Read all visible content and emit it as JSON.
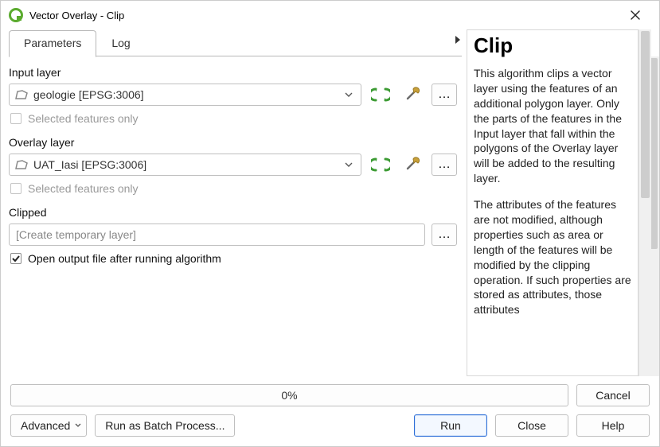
{
  "window": {
    "title": "Vector Overlay - Clip"
  },
  "tabs": {
    "parameters": "Parameters",
    "log": "Log"
  },
  "input": {
    "label": "Input layer",
    "value": "geologie [EPSG:3006]",
    "selected_only": "Selected features only"
  },
  "overlay": {
    "label": "Overlay layer",
    "value": "UAT_Iasi [EPSG:3006]",
    "selected_only": "Selected features only"
  },
  "output": {
    "label": "Clipped",
    "placeholder": "[Create temporary layer]",
    "open_after": "Open output file after running algorithm"
  },
  "help": {
    "title": "Clip",
    "p1": "This algorithm clips a vector layer using the features of an additional polygon layer. Only the parts of the features in the Input layer that fall within the polygons of the Overlay layer will be added to the resulting layer.",
    "p2": "The attributes of the features are not modified, although properties such as area or length of the features will be modified by the clipping operation. If such properties are stored as attributes, those attributes"
  },
  "footer": {
    "progress": "0%",
    "cancel": "Cancel",
    "advanced": "Advanced",
    "batch": "Run as Batch Process...",
    "run": "Run",
    "close": "Close",
    "help_btn": "Help"
  },
  "icons": {
    "ellipsis": "…"
  }
}
